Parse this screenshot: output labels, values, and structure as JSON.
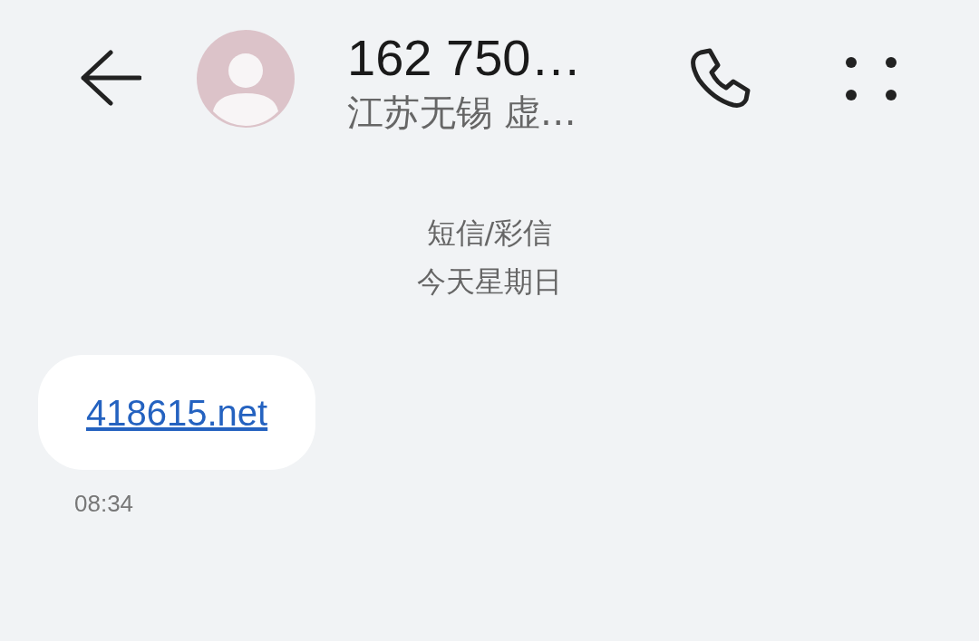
{
  "header": {
    "title": "162 750…",
    "subtitle": "江苏无锡 虚…"
  },
  "conversation": {
    "channel": "短信/彩信",
    "date": "今天星期日"
  },
  "messages": [
    {
      "kind": "link",
      "text": "418615.net",
      "time": "08:34"
    }
  ]
}
